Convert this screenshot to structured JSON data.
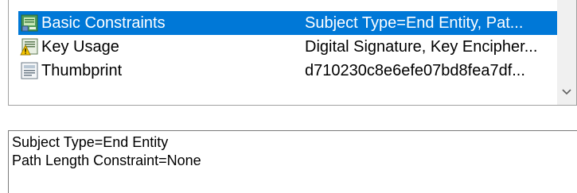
{
  "fields_list": {
    "rows": [
      {
        "field": "Basic Constraints",
        "value": "Subject Type=End Entity, Pat...",
        "icon": "certificate-extension-icon",
        "selected": true
      },
      {
        "field": "Key Usage",
        "value": "Digital Signature, Key Encipher...",
        "icon": "critical-extension-warning-icon",
        "selected": false
      },
      {
        "field": "Thumbprint",
        "value": "d710230c8e6efe07bd8fea7df...",
        "icon": "property-document-icon",
        "selected": false
      }
    ]
  },
  "detail_box": {
    "lines": [
      "Subject Type=End Entity",
      "Path Length Constraint=None"
    ]
  },
  "colors": {
    "selection": "#0078d7",
    "scrollbar": "#f0f0f0"
  }
}
